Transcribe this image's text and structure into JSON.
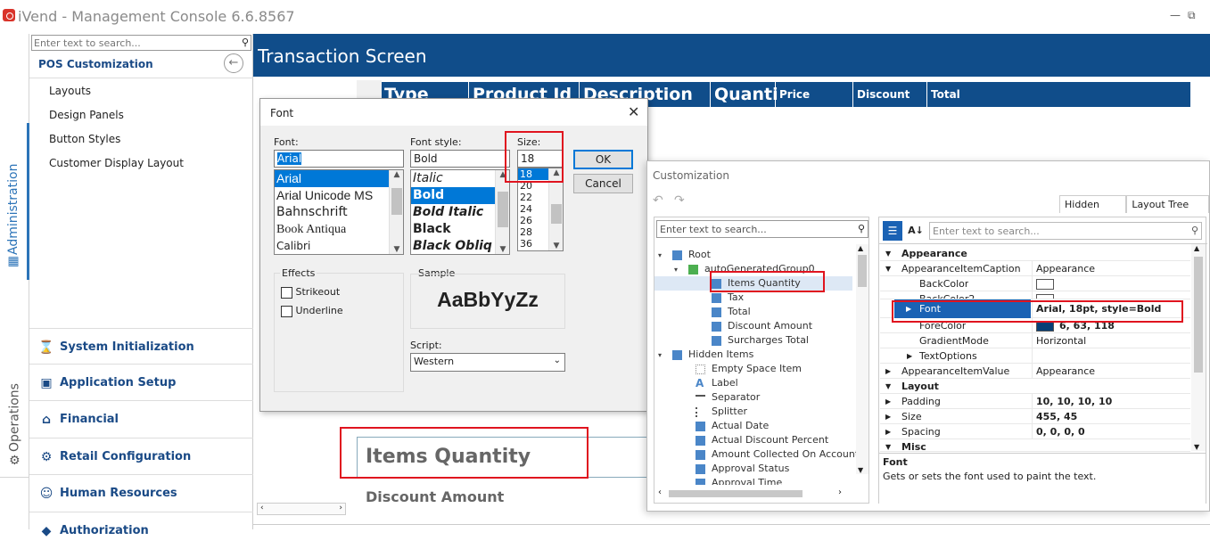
{
  "app": {
    "title": "iVend - Management Console  6.6.8567",
    "min": "—",
    "restore": "⧉"
  },
  "vtabs": {
    "administration": "Administration",
    "operations": "Operations"
  },
  "nav": {
    "search_placeholder": "Enter text to search...",
    "section_title": "POS Customization",
    "items": [
      "Layouts",
      "Design Panels",
      "Button Styles",
      "Customer Display Layout"
    ],
    "groups": [
      "System Initialization",
      "Application Setup",
      "Financial",
      "Retail Configuration",
      "Human Resources",
      "Authorization"
    ]
  },
  "header": {
    "title": "Transaction Screen"
  },
  "grid": {
    "columns": [
      "Type",
      "Product Id",
      "Description",
      "Quanti",
      "Price",
      "Discount",
      "Total"
    ]
  },
  "canvas": {
    "items_quantity": "Items Quantity",
    "discount_amount": "Discount Amount"
  },
  "font_dialog": {
    "title": "Font",
    "font_label": "Font:",
    "font_value": "Arial",
    "fonts": [
      "Arial",
      "Arial Unicode MS",
      "Bahnschrift",
      "Book Antiqua",
      "Calibri"
    ],
    "style_label": "Font style:",
    "style_value": "Bold",
    "styles": [
      "Italic",
      "Bold",
      "Bold Italic",
      "Black",
      "Black Obliq"
    ],
    "size_label": "Size:",
    "size_value": "18",
    "sizes": [
      "18",
      "20",
      "22",
      "24",
      "26",
      "28",
      "36"
    ],
    "ok": "OK",
    "cancel": "Cancel",
    "effects_label": "Effects",
    "strikeout": "Strikeout",
    "underline": "Underline",
    "sample_label": "Sample",
    "sample_text": "AaBbYyZz",
    "script_label": "Script:",
    "script_value": "Western"
  },
  "customization": {
    "title": "Customization",
    "tabs": [
      "Hidden Items",
      "Layout Tree View"
    ],
    "tree_search_placeholder": "Enter text to search...",
    "tree": {
      "root": "Root",
      "group": "autoGeneratedGroup0",
      "items": [
        "Items Quantity",
        "Tax",
        "Total",
        "Discount Amount",
        "Surcharges Total"
      ],
      "hidden": "Hidden Items",
      "hidden_items": [
        "Empty Space Item",
        "Label",
        "Separator",
        "Splitter",
        "Actual Date",
        "Actual Discount Percent",
        "Amount Collected On Account",
        "Approval Status",
        "Approval Time"
      ]
    },
    "prop_search_placeholder": "Enter text to search...",
    "props": {
      "cat_appearance": "Appearance",
      "appearance_item_caption": "AppearanceItemCaption",
      "appearance_item_caption_val": "Appearance",
      "backcolor": "BackColor",
      "backcolor2": "BackColor2",
      "font": "Font",
      "font_val": "Arial, 18pt, style=Bold",
      "forecolor": "ForeColor",
      "forecolor_val": "6, 63, 118",
      "forecolor_hex": "#063f76",
      "gradient": "GradientMode",
      "gradient_val": "Horizontal",
      "textoptions": "TextOptions",
      "appearance_item_value": "AppearanceItemValue",
      "appearance_item_value_val": "Appearance",
      "cat_layout": "Layout",
      "padding": "Padding",
      "padding_val": "10, 10, 10, 10",
      "size": "Size",
      "size_val": "455, 45",
      "spacing": "Spacing",
      "spacing_val": "0, 0, 0, 0",
      "cat_misc": "Misc"
    },
    "desc_name": "Font",
    "desc_text": "Gets or sets the font used to paint the text."
  }
}
